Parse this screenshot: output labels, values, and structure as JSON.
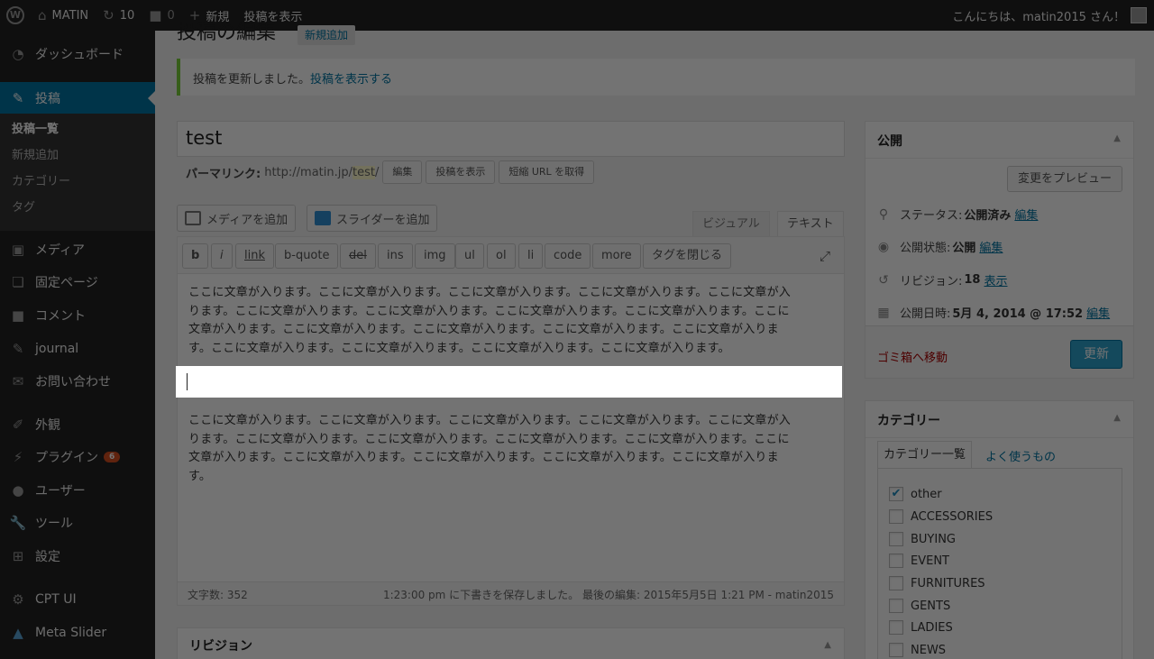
{
  "adminbar": {
    "site_name": "MATIN",
    "updates_count": "10",
    "comments_count": "0",
    "new_label": "新規",
    "view_post_label": "投稿を表示",
    "greeting": "こんにちは、matin2015 さん！"
  },
  "menu": {
    "dashboard": "ダッシュボード",
    "posts": "投稿",
    "posts_sub": {
      "all": "投稿一覧",
      "add_new": "新規追加",
      "categories": "カテゴリー",
      "tags": "タグ"
    },
    "media": "メディア",
    "pages": "固定ページ",
    "comments": "コメント",
    "journal": "journal",
    "contact": "お問い合わせ",
    "appearance": "外観",
    "plugins": "プラグイン",
    "plugins_badge": "6",
    "users": "ユーザー",
    "tools": "ツール",
    "settings": "設定",
    "cpt_ui": "CPT UI",
    "meta_slider": "Meta Slider"
  },
  "page": {
    "heading": "投稿の編集",
    "add_new": "新規追加",
    "notice_text": "投稿を更新しました。",
    "notice_link": "投稿を表示する"
  },
  "post": {
    "title": "test",
    "permalink_label": "パーマリンク:",
    "permalink_base": "http://matin.jp/",
    "permalink_slug": "test",
    "permalink_suffix": "/",
    "edit_btn": "編集",
    "view_btn": "投稿を表示",
    "shortlink_btn": "短縮 URL を取得"
  },
  "editor": {
    "add_media": "メディアを追加",
    "add_slider": "スライダーを追加",
    "tab_visual": "ビジュアル",
    "tab_text": "テキスト",
    "quicktags": [
      "b",
      "i",
      "link",
      "b-quote",
      "del",
      "ins",
      "img",
      "ul",
      "ol",
      "li",
      "code",
      "more",
      "タグを閉じる"
    ],
    "para1_lines": [
      "ここに文章が入ります。ここに文章が入ります。ここに文章が入ります。ここに文章が入ります。ここに文章が入",
      "ります。ここに文章が入ります。ここに文章が入ります。ここに文章が入ります。ここに文章が入ります。ここに",
      "文章が入ります。ここに文章が入ります。ここに文章が入ります。ここに文章が入ります。ここに文章が入りま",
      "す。ここに文章が入ります。ここに文章が入ります。ここに文章が入ります。ここに文章が入ります。"
    ],
    "para2_lines": [
      "ここに文章が入ります。ここに文章が入ります。ここに文章が入ります。ここに文章が入ります。ここに文章が入",
      "ります。ここに文章が入ります。ここに文章が入ります。ここに文章が入ります。ここに文章が入ります。ここに",
      "文章が入ります。ここに文章が入ります。ここに文章が入ります。ここに文章が入ります。ここに文章が入りま",
      "す。"
    ],
    "word_count": "文字数: 352",
    "last_edit": "1:23:00 pm に下書きを保存しました。 最後の編集: 2015年5月5日 1:21 PM - matin2015"
  },
  "publish": {
    "title": "公開",
    "preview_btn": "変更をプレビュー",
    "status_label": "ステータス:",
    "status_value": "公開済み",
    "visibility_label": "公開状態:",
    "visibility_value": "公開",
    "revisions_label": "リビジョン:",
    "revisions_value": "18",
    "revisions_link": "表示",
    "date_label": "公開日時:",
    "date_value": "5月 4, 2014 @ 17:52",
    "edit_link": "編集",
    "trash_link": "ゴミ箱へ移動",
    "update_btn": "更新"
  },
  "categories": {
    "title": "カテゴリー",
    "tab_all": "カテゴリー一覧",
    "tab_popular": "よく使うもの",
    "items": [
      {
        "label": "other",
        "checked": true
      },
      {
        "label": "ACCESSORIES",
        "checked": false
      },
      {
        "label": "BUYING",
        "checked": false
      },
      {
        "label": "EVENT",
        "checked": false
      },
      {
        "label": "FURNITURES",
        "checked": false
      },
      {
        "label": "GENTS",
        "checked": false
      },
      {
        "label": "LADIES",
        "checked": false
      },
      {
        "label": "NEWS",
        "checked": false
      }
    ]
  },
  "revisions": {
    "title": "リビジョン"
  }
}
